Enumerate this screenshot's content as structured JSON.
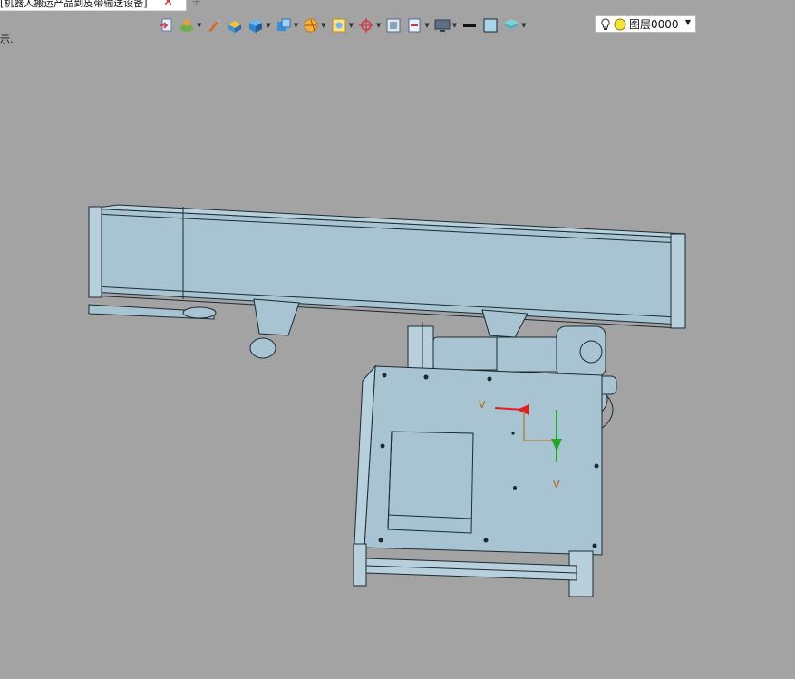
{
  "tab": {
    "title": "[机器人搬运产品到皮带输送设备]",
    "close_glyph": "✕",
    "new_tab_glyph": "+"
  },
  "hint_text": "示.",
  "toolbar": {
    "icons": [
      "import-icon",
      "material-icon",
      "brush-icon",
      "face-color-icon",
      "solid-icon",
      "render-mode-icon",
      "section-icon",
      "view-area-icon",
      "coordinate-icon",
      "frame-icon",
      "dimension-icon",
      "display-icon",
      "line-icon",
      "fill-icon",
      "layer-stack-icon"
    ]
  },
  "layer": {
    "label": "图层0000"
  },
  "triad": {
    "x_label": "V",
    "y_label": "V"
  },
  "colors": {
    "viewport_bg": "#a3a3a3",
    "model_fill": "#a8c4d2",
    "model_edge": "#1c2a30",
    "axis_red": "#e02020",
    "axis_green": "#1fa82a",
    "axis_label": "#b06a00"
  }
}
